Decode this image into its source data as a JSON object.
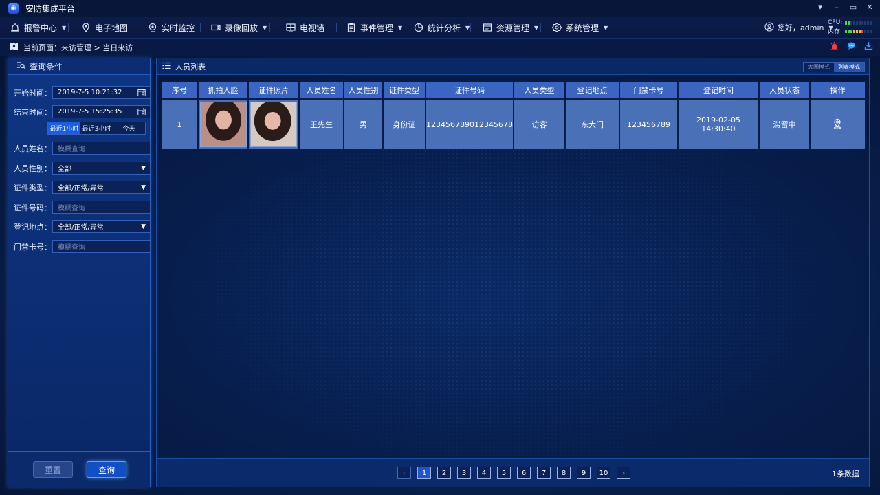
{
  "app": {
    "title": "安防集成平台"
  },
  "window": {
    "minimize": "–",
    "restore": "▭",
    "close": "✕",
    "menu": "▾"
  },
  "nav": {
    "items": [
      {
        "label": "报警中心",
        "caret": true
      },
      {
        "label": "电子地图",
        "caret": false
      },
      {
        "label": "实时监控",
        "caret": false
      },
      {
        "label": "录像回放",
        "caret": true
      },
      {
        "label": "电视墙",
        "caret": false
      },
      {
        "label": "事件管理",
        "caret": true
      },
      {
        "label": "统计分析",
        "caret": true
      },
      {
        "label": "资源管理",
        "caret": true
      },
      {
        "label": "系统管理",
        "caret": true
      }
    ],
    "user_greeting": "您好，admin",
    "cpu_label": "CPU:",
    "mem_label": "内存:"
  },
  "breadcrumb": {
    "text": "当前页面：来访管理 > 当日来访"
  },
  "query": {
    "title": "查询条件",
    "start_label": "开始时间：",
    "start_value": "2019-7-5  10:21:32",
    "end_label": "结束时间：",
    "end_value": "2019-7-5  15:25:35",
    "quick": [
      "最近1小时",
      "最近3小时",
      "今天"
    ],
    "name_label": "人员姓名：",
    "name_placeholder": "模糊查询",
    "gender_label": "人员性别：",
    "gender_value": "全部",
    "idtype_label": "证件类型：",
    "idtype_value": "全部/正常/异常",
    "idno_label": "证件号码：",
    "idno_placeholder": "模糊查询",
    "place_label": "登记地点：",
    "place_value": "全部/正常/异常",
    "card_label": "门禁卡号：",
    "card_placeholder": "模糊查询",
    "reset": "重置",
    "submit": "查询"
  },
  "list": {
    "title": "人员列表",
    "mode_big": "大图模式",
    "mode_list": "列表模式",
    "columns": [
      "序号",
      "抓拍人脸",
      "证件照片",
      "人员姓名",
      "人员性别",
      "证件类型",
      "证件号码",
      "人员类型",
      "登记地点",
      "门禁卡号",
      "登记时间",
      "人员状态",
      "操作"
    ],
    "rows": [
      {
        "index": "1",
        "name": "王先生",
        "gender": "男",
        "id_type": "身份证",
        "id_no": "123456789012345678",
        "person_type": "访客",
        "place": "东大门",
        "card": "123456789",
        "time": "2019-02-05 14:30:40",
        "status": "滞留中"
      }
    ],
    "pages": [
      "1",
      "2",
      "3",
      "4",
      "5",
      "6",
      "7",
      "8",
      "9",
      "10"
    ],
    "prev": "‹",
    "next": "›",
    "total": "1条数据"
  }
}
